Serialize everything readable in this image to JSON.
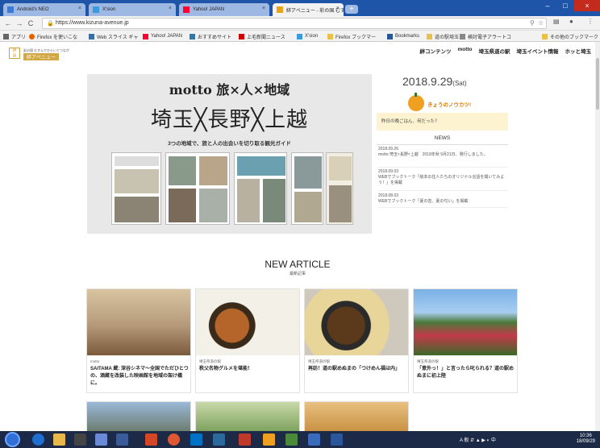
{
  "browser": {
    "tabs": [
      {
        "label": "Android's NEO",
        "favicon_color": "#3c78d8",
        "active": false
      },
      {
        "label": "X'sion",
        "favicon_color": "#3a9bdc",
        "active": false
      },
      {
        "label": "Yahoo! JAPAN",
        "favicon_color": "#ff0033",
        "active": false
      },
      {
        "label": "絆アベニュー - 彩の国 むすんで",
        "favicon_color": "#e8a317",
        "active": true
      }
    ],
    "new_tab": "+",
    "window_controls": {
      "minimize": "–",
      "maximize": "□",
      "close": "×"
    },
    "nav": {
      "back": "←",
      "forward": "→",
      "reload": "C"
    },
    "url": "https://www.kizuna-avenue.jp",
    "bookmarks": [
      {
        "label": "アプリ",
        "icon": "apps-icon",
        "color": "#666"
      },
      {
        "label": "Firefox を使いこな",
        "icon": "firefox-icon",
        "color": "#e66000"
      },
      {
        "label": "Web スライス ギャ",
        "icon": "web-slice-icon",
        "color": "#3a6ea5"
      },
      {
        "label": "Yahoo! JAPAN",
        "icon": "yahoo-icon",
        "color": "#ff0033"
      },
      {
        "label": "おすすめサイト",
        "icon": "recommend-icon",
        "color": "#2a7ab0"
      },
      {
        "label": "上毛新聞ニュース",
        "icon": "news-icon",
        "color": "#c00"
      },
      {
        "label": "X'sion",
        "icon": "xsion-icon",
        "color": "#3a9bdc"
      },
      {
        "label": "Firefox ブックマー",
        "icon": "folder-icon",
        "color": "#e8c04a"
      },
      {
        "label": "Bookmarks",
        "icon": "star-icon",
        "color": "#2b5797"
      },
      {
        "label": "道の駅埼玉",
        "icon": "folder-icon",
        "color": "#e8c04a"
      },
      {
        "label": "検討電子アラートコ",
        "icon": "page-icon",
        "color": "#888"
      },
      {
        "label": "その他のブックマーク",
        "icon": "folder-icon",
        "color": "#e8c04a"
      }
    ]
  },
  "site": {
    "logo_small": "彩の国 むすんでひらいてつながる",
    "logo_name": "絆アベニュー",
    "nav": [
      "絆コンテンツ",
      "motto",
      "埼玉県道の駅",
      "埼玉イベント情報",
      "ホッと埼玉"
    ],
    "hero": {
      "subtitle": "motto 旅×人×地域",
      "main": "埼玉╳長野╳上越",
      "caption": "3つの地域で、旅と人の出会いを切り取る観光ガイド"
    },
    "date": "2018.9.29",
    "weekday": "(Sat)",
    "kyou_label": "きょうのノウカツ!",
    "kyou_text": "昨日の晩ごはん、何だった？",
    "news_title": "NEWS",
    "news": [
      {
        "date": "2018.09.26",
        "text": "motto 埼玉×長野×上越　2018年秋 9月21日、発行しました。"
      },
      {
        "date": "2018.09.03",
        "text": "WEBでブックトーク「絵本の住人たちのオリジナル言語を聞いてみよう！」を掲載"
      },
      {
        "date": "2018.08.03",
        "text": "WEBでブックトーク「夏の音、夏の匂い」を掲載"
      }
    ],
    "section_title": "NEW ARTICLE",
    "section_sub": "最新記事",
    "articles": [
      {
        "category": "motto",
        "title": "SAITAMA 蔵: 深谷シネマ～全国でただひとつの、酒蔵を改装した映画館を地域の架け橋に。",
        "img_color": "#b59a7a"
      },
      {
        "category": "埼玉県道の駅",
        "title": "秩父名物グルメを堪能！",
        "img_color": "#6b4a2e"
      },
      {
        "category": "埼玉県道の駅",
        "title": "再訪！道の駅めぬまの「つけめん福は内」",
        "img_color": "#5a5040"
      },
      {
        "category": "埼玉県道の駅",
        "title": "「意外っ！」と言ったら叱られる？道の駅めぬまに初上陸",
        "img_color": "#c23a4a"
      }
    ]
  },
  "taskbar": {
    "time": "10:36",
    "date": "18/09/29",
    "tray_text": "A 般 ⇵ ▲ ▶ ◐ 中"
  }
}
